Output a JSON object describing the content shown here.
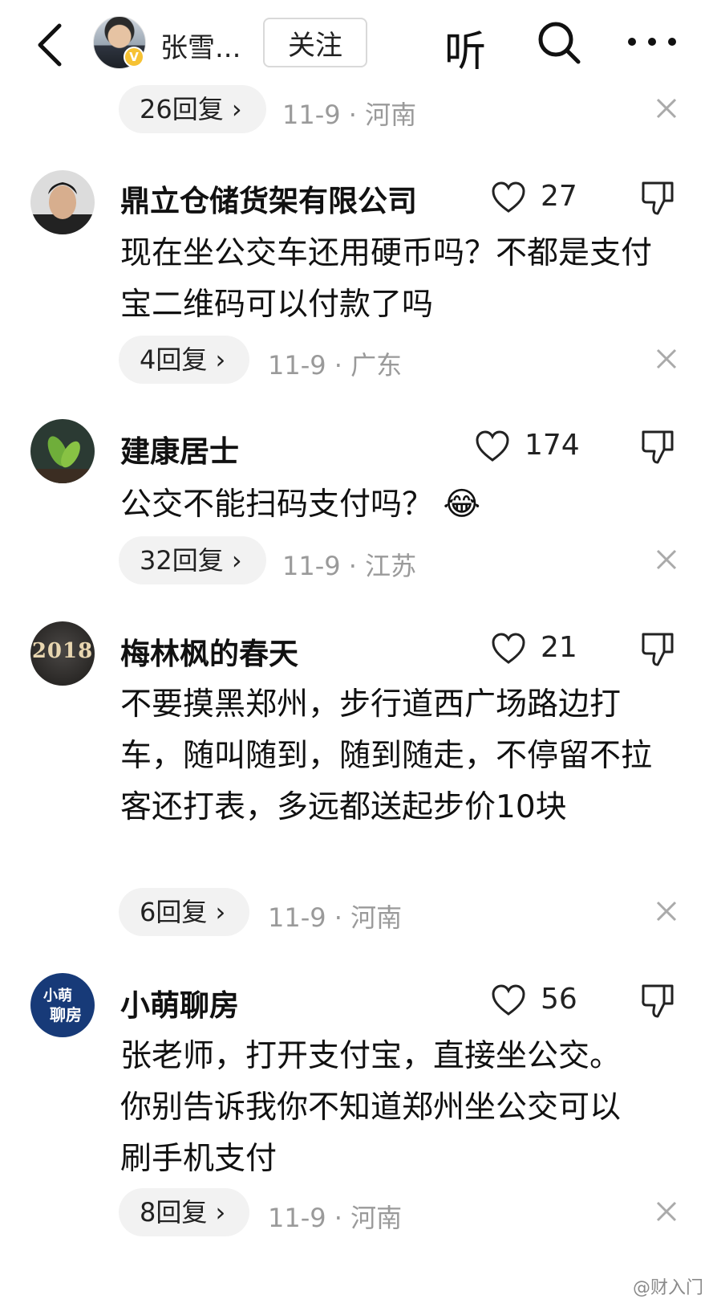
{
  "header": {
    "author_name": "张雪...",
    "verified_badge": "V",
    "follow_label": "关注",
    "listen_label": "听"
  },
  "comments": [
    {
      "id": 0,
      "replies": "26回复 ›",
      "date_location": "11-9 · 河南"
    },
    {
      "id": 1,
      "name": "鼎立仓储货架有限公司",
      "likes": "27",
      "text": "现在坐公交车还用硬币吗？不都是支付宝二维码可以付款了吗",
      "replies": "4回复 ›",
      "date_location": "11-9 · 广东"
    },
    {
      "id": 2,
      "name": "建康居士",
      "likes": "174",
      "text": "公交不能扫码支付吗？",
      "emoji": "😂",
      "replies": "32回复 ›",
      "date_location": "11-9 · 江苏"
    },
    {
      "id": 3,
      "name": "梅林枫的春天",
      "likes": "21",
      "text": "不要摸黑郑州，步行道西广场路边打车，随叫随到，随到随走，不停留不拉客还打表，多远都送起步价10块",
      "replies": "6回复 ›",
      "date_location": "11-9 · 河南",
      "avatar_text": "2018"
    },
    {
      "id": 4,
      "name": "小萌聊房",
      "likes": "56",
      "text": "张老师，打开支付宝，直接坐公交。你别告诉我你不知道郑州坐公交可以刷手机支付",
      "replies": "8回复 ›",
      "date_location": "11-9 · 河南",
      "avatar_line1": "小萌",
      "avatar_line2": "聊房"
    }
  ],
  "watermark": "@财入门",
  "colors": {
    "muted": "#9a9a9a",
    "pill": "#f2f2f2",
    "badge": "#f6c233",
    "avatar_blue": "#173a78"
  }
}
